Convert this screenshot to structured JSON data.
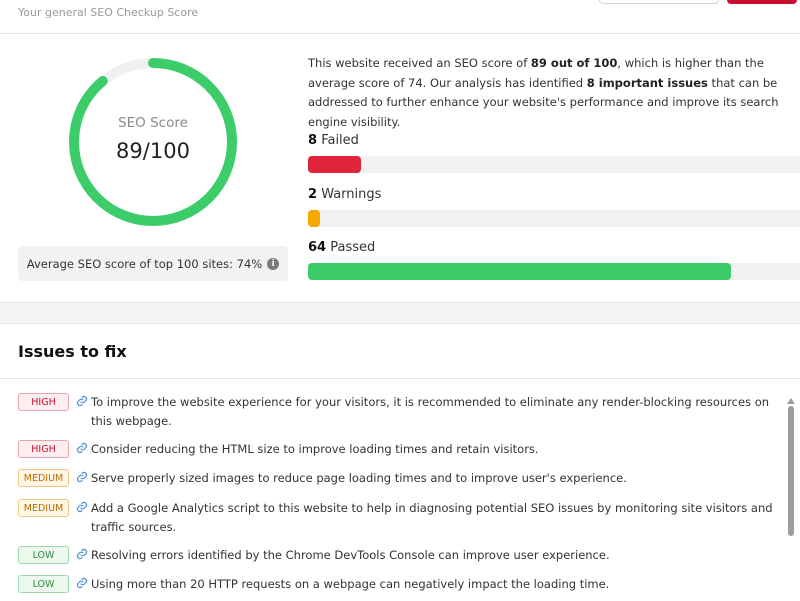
{
  "header": {
    "subtitle": "Your general SEO Checkup Score"
  },
  "score": {
    "label": "SEO Score",
    "value": 89,
    "max": 100,
    "display": "89/100",
    "ring_color": "#3dcc6a",
    "track_color": "#f0f0f0"
  },
  "average": {
    "text": "Average SEO score of top 100 sites: 74%",
    "info_icon": "info-icon"
  },
  "summary": {
    "part1": "This website received an SEO score of ",
    "score_bold": "89 out of 100",
    "part2": ", which is higher than the average score of 74. Our analysis has identified ",
    "issues_bold": "8 important issues",
    "part3": " that can be addressed to further enhance your website's performance and improve its search engine visibility."
  },
  "metrics": {
    "failed": {
      "count": "8",
      "label": "Failed",
      "fraction": 0.107,
      "color": "#e0243c"
    },
    "warnings": {
      "count": "2",
      "label": "Warnings",
      "fraction": 0.025,
      "color": "#f5a800"
    },
    "passed": {
      "count": "64",
      "label": "Passed",
      "fraction": 0.86,
      "color": "#3dcc6a"
    }
  },
  "issues": {
    "title": "Issues to fix",
    "items": [
      {
        "severity": "HIGH",
        "level": "high",
        "text": "To improve the website experience for your visitors, it is recommended to eliminate any render-blocking resources on this webpage."
      },
      {
        "severity": "HIGH",
        "level": "high",
        "text": "Consider reducing the HTML size to improve loading times and retain visitors."
      },
      {
        "severity": "MEDIUM",
        "level": "medium",
        "text": "Serve properly sized images to reduce page loading times and to improve user's experience."
      },
      {
        "severity": "MEDIUM",
        "level": "medium",
        "text": "Add a Google Analytics script to this website to help in diagnosing potential SEO issues by monitoring site visitors and traffic sources."
      },
      {
        "severity": "LOW",
        "level": "low",
        "text": "Resolving errors identified by the Chrome DevTools Console can improve user experience."
      },
      {
        "severity": "LOW",
        "level": "low",
        "text": "Using more than 20 HTTP requests on a webpage can negatively impact the loading time."
      }
    ]
  },
  "colors": {
    "accent_red": "#c8102e",
    "link_icon": "#4a8fd6"
  }
}
